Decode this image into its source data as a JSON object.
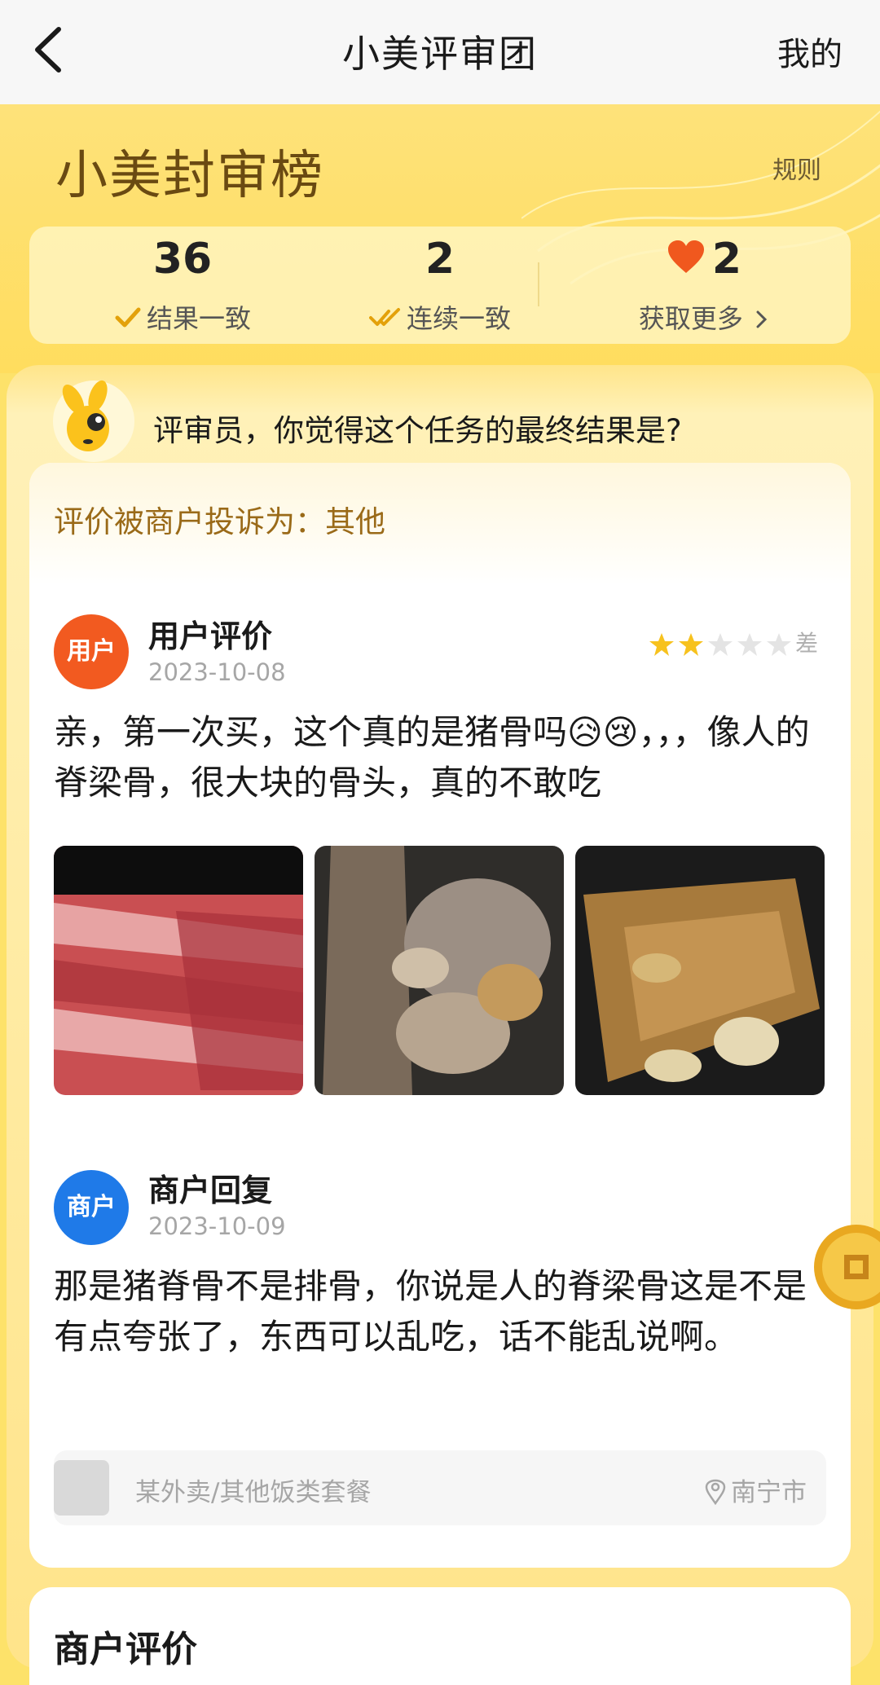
{
  "topbar": {
    "title": "小美评审团",
    "right": "我的"
  },
  "hero": {
    "title": "小美封审榜",
    "rules": "规则"
  },
  "stats": [
    {
      "value": "36",
      "label": "结果一致"
    },
    {
      "value": "2",
      "label": "连续一致"
    },
    {
      "value": "2",
      "label": "获取更多"
    }
  ],
  "question": "评审员，你觉得这个任务的最终结果是?",
  "complaint": "评价被商户投诉为：其他",
  "user_review": {
    "badge": "用户",
    "name": "用户评价",
    "date": "2023-10-08",
    "rating_text": "差",
    "stars": 2,
    "text": "亲，第一次买，这个真的是猪骨吗😥😢，，，像人的脊梁骨，很大块的骨头，真的不敢吃"
  },
  "merchant_reply": {
    "badge": "商户",
    "name": "商户回复",
    "date": "2023-10-09",
    "text": "那是猪脊骨不是排骨，你说是人的脊梁骨这是不是有点夸张了，东西可以乱吃，话不能乱说啊。"
  },
  "footer": {
    "category": "某外卖/其他饭类套餐",
    "location": "南宁市"
  },
  "next_section": {
    "title": "商户评价"
  },
  "colors": {
    "accent": "#fde26a",
    "user_badge": "#f25a20",
    "merchant_badge": "#1f7ae8",
    "star": "#f7c21e"
  }
}
